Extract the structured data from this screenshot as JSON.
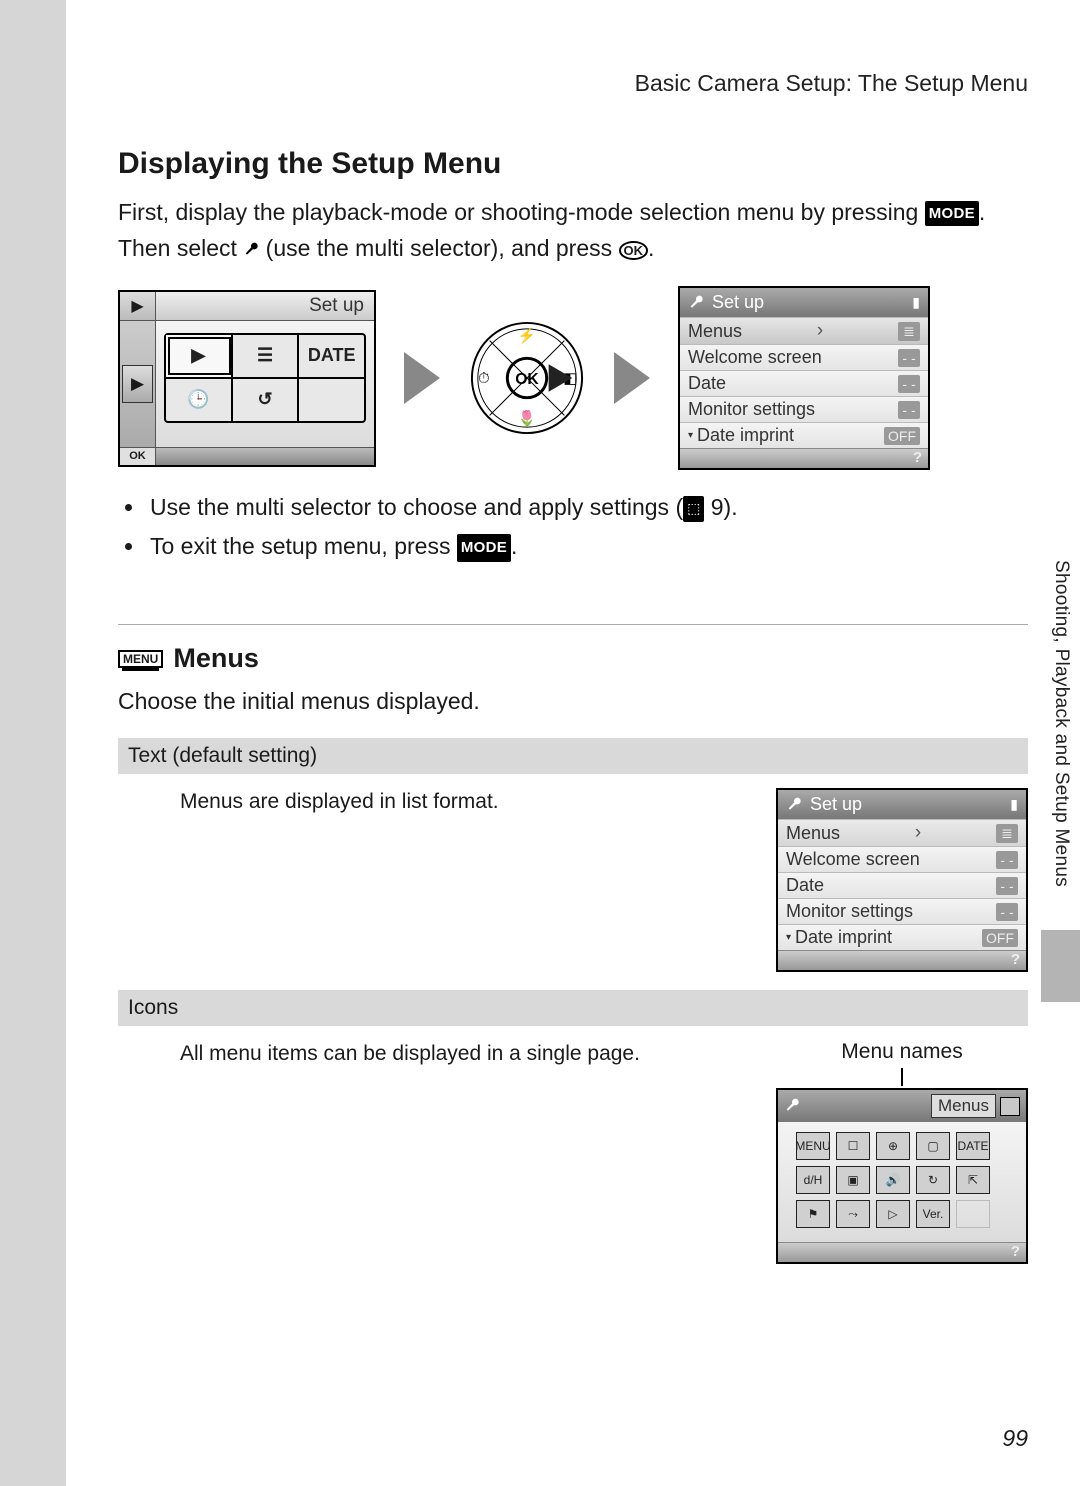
{
  "header": {
    "breadcrumb": "Basic Camera Setup: The Setup Menu"
  },
  "h1": "Displaying the Setup Menu",
  "intro_1": "First, display the playback-mode or shooting-mode selection menu by pressing ",
  "intro_mode": "MODE",
  "intro_2": ". Then select ",
  "intro_3": " (use the multi selector), and press ",
  "intro_ok": "OK",
  "intro_4": ".",
  "lcd1": {
    "title": "Set up",
    "cells_row1": [
      "▶",
      "☰",
      "DATE"
    ],
    "cells_row2": [
      "🕒",
      "↺",
      ""
    ],
    "bottom_ok": "OK"
  },
  "dial": {
    "center": "OK"
  },
  "lcd2": {
    "title": "Set up",
    "rows": [
      {
        "label": "Menus",
        "val": "",
        "arrow": true,
        "icon": "≣"
      },
      {
        "label": "Welcome screen",
        "val": "- -"
      },
      {
        "label": "Date",
        "val": "- -"
      },
      {
        "label": "Monitor settings",
        "val": "- -"
      },
      {
        "label": "Date imprint",
        "val": "OFF",
        "dot": true
      }
    ],
    "foot": "?"
  },
  "bullets": [
    {
      "pre": "Use the multi selector to choose and apply settings (",
      "ref": "9",
      "post": ")."
    },
    {
      "pre": "To exit the setup menu, press ",
      "mode": "MODE",
      "post": "."
    }
  ],
  "menus": {
    "badge": "MENU",
    "title": "Menus",
    "desc": "Choose the initial menus displayed."
  },
  "option_text": {
    "header": "Text (default setting)",
    "desc": "Menus are displayed in list format."
  },
  "option_icons": {
    "header": "Icons",
    "desc": "All menu items can be displayed in a single page.",
    "menu_names": "Menu names",
    "lcd3_title": "Menus",
    "lcd3_cells": [
      [
        "MENU",
        "☐",
        "⊕",
        "▢",
        "DATE"
      ],
      [
        "d/H",
        "▣",
        "🔊",
        "↻",
        "⇱"
      ],
      [
        "⚑",
        "⤳",
        "▷",
        "Ver.",
        ""
      ]
    ],
    "lcd3_foot": "?"
  },
  "side_label": "Shooting, Playback and Setup Menus",
  "page_number": "99"
}
